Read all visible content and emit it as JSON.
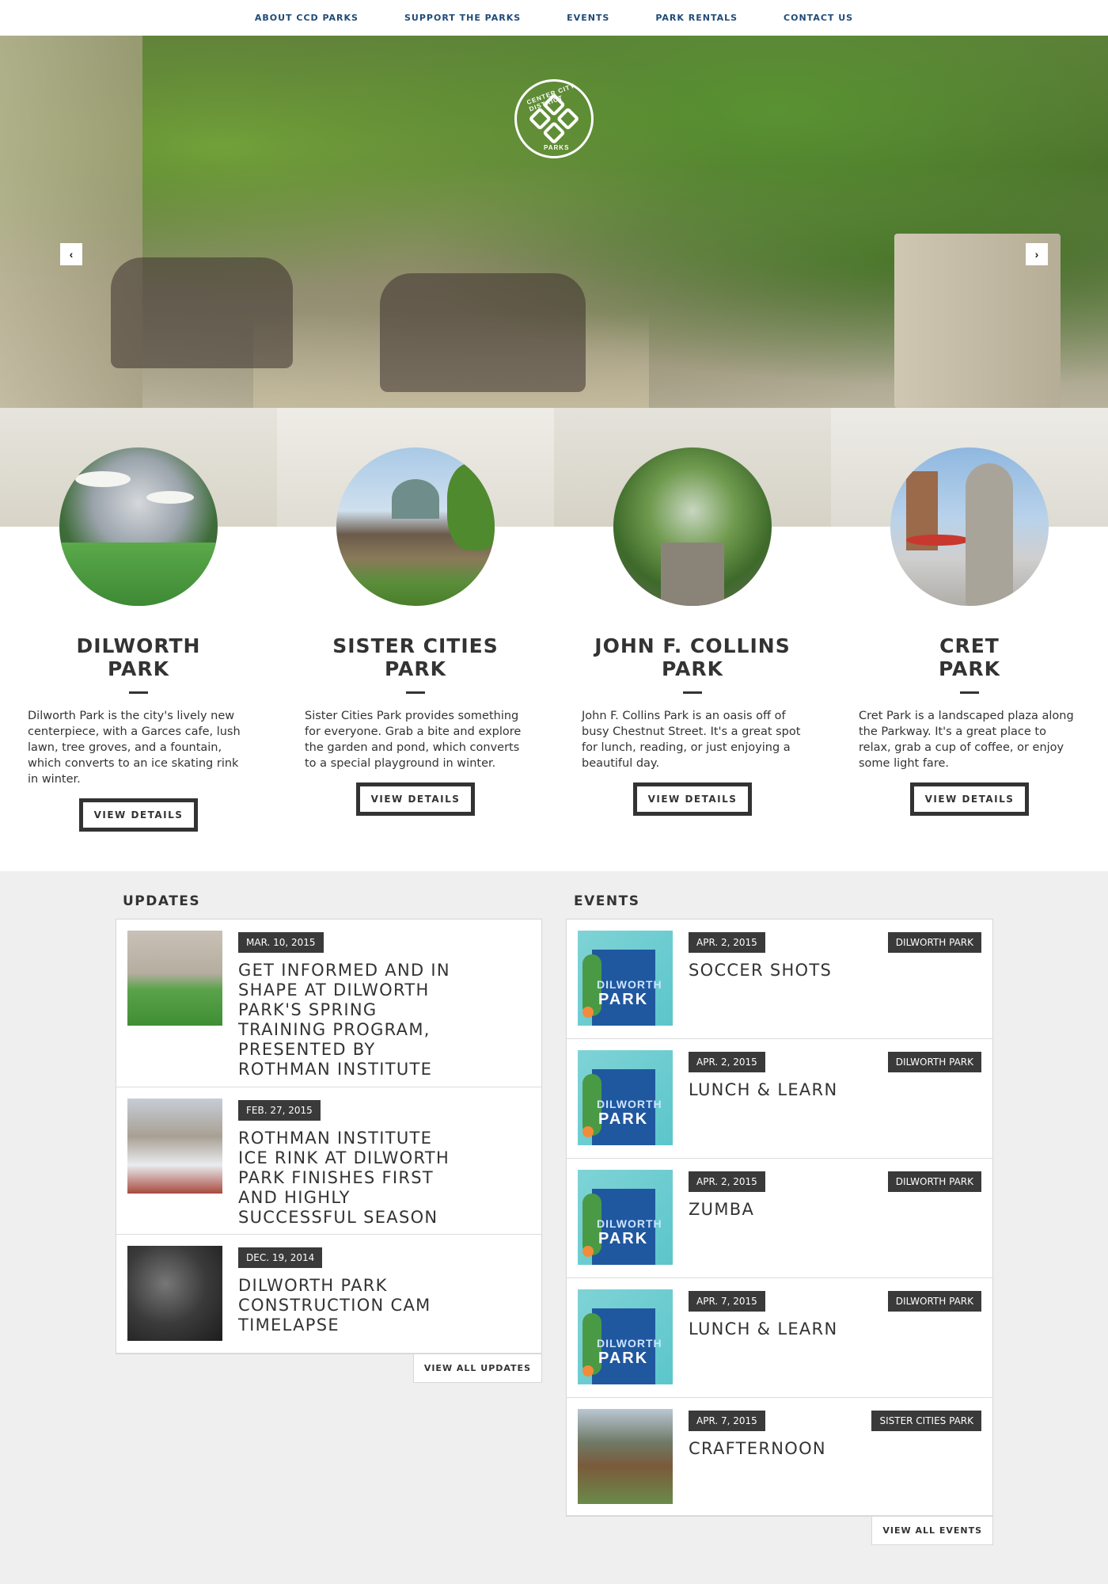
{
  "nav": {
    "items": [
      "ABOUT CCD PARKS",
      "SUPPORT THE PARKS",
      "EVENTS",
      "PARK RENTALS",
      "CONTACT US"
    ]
  },
  "hero": {
    "logo_top": "CENTER CITY DISTRICT",
    "logo_bottom": "PARKS",
    "prev_icon": "‹",
    "next_icon": "›"
  },
  "parks": [
    {
      "title_line1": "DILWORTH",
      "title_line2": "PARK",
      "description": "Dilworth Park is the city's lively new centerpiece, with a Garces cafe, lush lawn, tree groves, and a fountain, which converts to an ice skating rink in winter.",
      "button": "VIEW DETAILS"
    },
    {
      "title_line1": "SISTER CITIES",
      "title_line2": "PARK",
      "description": "Sister Cities Park provides something for everyone. Grab a bite and explore the garden and pond, which converts to a special playground in winter.",
      "button": "VIEW DETAILS"
    },
    {
      "title_line1": "JOHN F. COLLINS",
      "title_line2": "PARK",
      "description": "John F. Collins Park is an oasis off of busy Chestnut Street. It's a great spot for lunch, reading, or just enjoying a beautiful day.",
      "button": "VIEW DETAILS"
    },
    {
      "title_line1": "CRET",
      "title_line2": "PARK",
      "description": "Cret Park is a landscaped plaza along the Parkway. It's a great place to relax, grab a cup of coffee, or enjoy some light fare.",
      "button": "VIEW DETAILS"
    }
  ],
  "updates": {
    "heading": "UPDATES",
    "items": [
      {
        "date": "MAR. 10, 2015",
        "title": "GET INFORMED AND IN SHAPE AT DILWORTH PARK'S SPRING TRAINING PROGRAM, PRESENTED BY ROTHMAN INSTITUTE"
      },
      {
        "date": "FEB. 27, 2015",
        "title": "ROTHMAN INSTITUTE ICE RINK AT DILWORTH PARK FINISHES FIRST AND HIGHLY SUCCESSFUL SEASON"
      },
      {
        "date": "DEC. 19, 2014",
        "title": "DILWORTH PARK CONSTRUCTION CAM TIMELAPSE"
      }
    ],
    "view_all": "VIEW ALL UPDATES"
  },
  "events": {
    "heading": "EVENTS",
    "items": [
      {
        "date": "APR. 2, 2015",
        "tag": "DILWORTH PARK",
        "title": "SOCCER SHOTS"
      },
      {
        "date": "APR. 2, 2015",
        "tag": "DILWORTH PARK",
        "title": "LUNCH & LEARN"
      },
      {
        "date": "APR. 2, 2015",
        "tag": "DILWORTH PARK",
        "title": "ZUMBA"
      },
      {
        "date": "APR. 7, 2015",
        "tag": "DILWORTH PARK",
        "title": "LUNCH & LEARN"
      },
      {
        "date": "APR. 7, 2015",
        "tag": "SISTER CITIES PARK",
        "title": "CRAFTERNOON"
      }
    ],
    "art_word1": "DILWORTH",
    "art_word2": "PARK",
    "view_all": "VIEW ALL EVENTS"
  },
  "colors": {
    "nav_link": "#1f4a78",
    "dark_text": "#333333",
    "date_badge": "#3a3a3a",
    "news_bg": "#eeefee"
  }
}
